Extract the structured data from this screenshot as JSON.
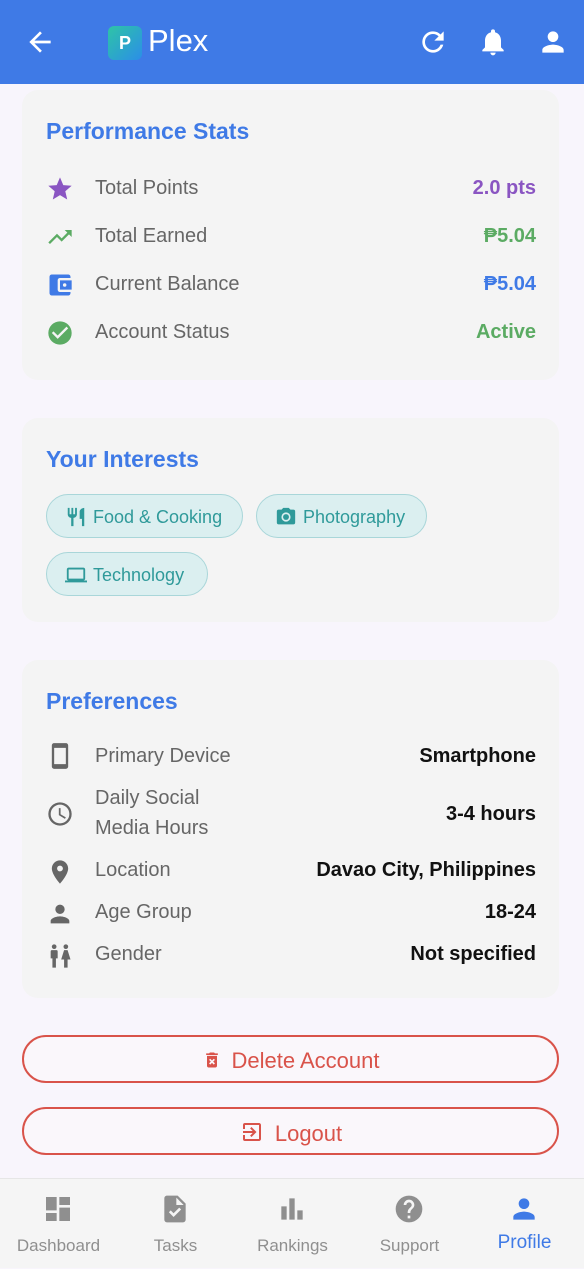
{
  "app": {
    "brand": "Plex",
    "logo_letter": "P"
  },
  "performance": {
    "title": "Performance Stats",
    "rows": [
      {
        "label": "Total Points",
        "value": "2.0 pts",
        "icon": "star-icon",
        "color": "#8a55c2"
      },
      {
        "label": "Total Earned",
        "value": "₱5.04",
        "icon": "trending-up-icon",
        "color": "#5bab63"
      },
      {
        "label": "Current Balance",
        "value": "₱5.04",
        "icon": "wallet-icon",
        "color": "#3f7ae6"
      },
      {
        "label": "Account Status",
        "value": "Active",
        "icon": "check-circle-icon",
        "color": "#5bab63"
      }
    ]
  },
  "interests": {
    "title": "Your Interests",
    "chips": [
      {
        "label": "Food & Cooking",
        "icon": "utensils-icon"
      },
      {
        "label": "Photography",
        "icon": "camera-icon"
      },
      {
        "label": "Technology",
        "icon": "laptop-icon"
      }
    ]
  },
  "preferences": {
    "title": "Preferences",
    "rows": [
      {
        "label": "Primary Device",
        "value": "Smartphone",
        "icon": "phone-icon"
      },
      {
        "label_line1": "Daily Social",
        "label_line2": "Media Hours",
        "value": "3-4 hours",
        "icon": "clock-icon"
      },
      {
        "label": "Location",
        "value": "Davao City, Philippines",
        "icon": "location-pin-icon"
      },
      {
        "label": "Age Group",
        "value": "18-24",
        "icon": "person-icon"
      },
      {
        "label": "Gender",
        "value": "Not specified",
        "icon": "gender-icon"
      }
    ]
  },
  "actions": {
    "delete_label": "Delete Account",
    "logout_label": "Logout",
    "danger_color": "#d9534a"
  },
  "nav": {
    "items": [
      {
        "label": "Dashboard",
        "icon": "dashboard-icon"
      },
      {
        "label": "Tasks",
        "icon": "tasks-icon"
      },
      {
        "label": "Rankings",
        "icon": "rankings-icon"
      },
      {
        "label": "Support",
        "icon": "help-icon"
      },
      {
        "label": "Profile",
        "icon": "profile-icon",
        "active": true
      }
    ],
    "active_color": "#3f7ae6"
  },
  "colors": {
    "accent": "#3f7ae6",
    "chip_text": "#2f9a9a"
  }
}
